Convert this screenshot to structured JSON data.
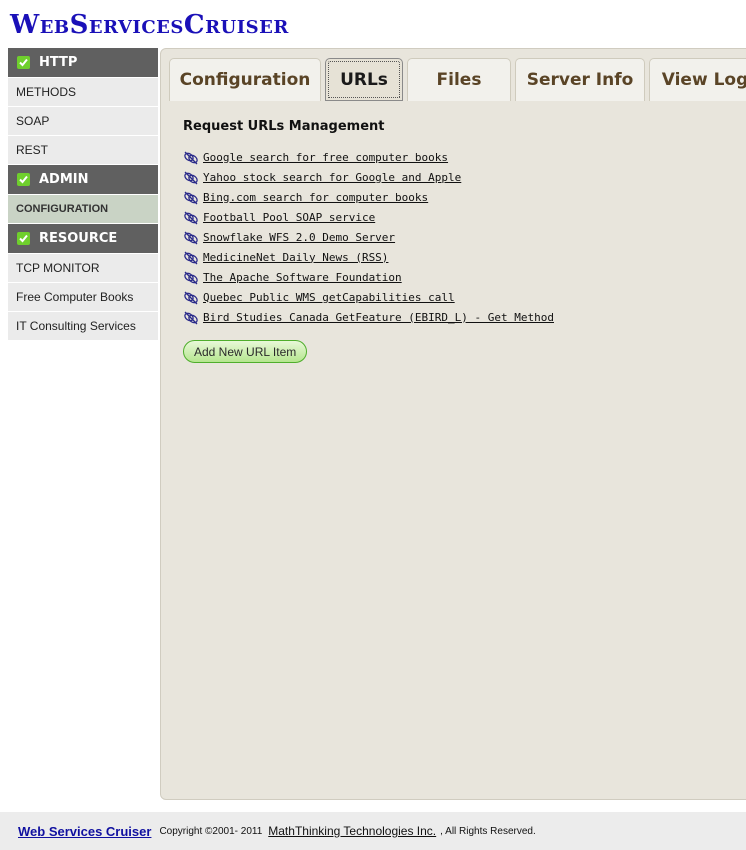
{
  "app": {
    "title": "WebServicesCruiser"
  },
  "sidebar": {
    "sections": [
      {
        "header": "HTTP",
        "items": [
          "METHODS",
          "SOAP",
          "REST"
        ]
      },
      {
        "header": "ADMIN",
        "items": [
          "CONFIGURATION"
        ]
      },
      {
        "header": "RESOURCE",
        "items": [
          "TCP MONITOR",
          "Free Computer Books",
          "IT Consulting Services"
        ]
      }
    ],
    "active_item": "CONFIGURATION"
  },
  "tabs": [
    {
      "label": "Configuration"
    },
    {
      "label": "URLs"
    },
    {
      "label": "Files"
    },
    {
      "label": "Server Info"
    },
    {
      "label": "View Log"
    }
  ],
  "active_tab": "URLs",
  "main": {
    "heading": "Request URLs Management",
    "urls": [
      "Google search for free computer books",
      "Yahoo stock search for Google and Apple",
      "Bing.com search for computer books",
      "Football Pool SOAP service",
      "Snowflake WFS 2.0 Demo Server",
      "MedicineNet Daily News (RSS)",
      "The Apache Software Foundation",
      "Quebec Public WMS getCapabilities call",
      "Bird Studies Canada GetFeature (EBIRD_L) - Get Method"
    ],
    "url_icon": "link-icon",
    "add_button": "Add New URL Item"
  },
  "footer": {
    "brand": "Web Services Cruiser",
    "copyright": "Copyright ©2001- 2011",
    "company": "MathThinking Technologies Inc.",
    "rights": ", All Rights Reserved."
  },
  "colors": {
    "logo": "#1a10b8",
    "sidebar_header": "#606060",
    "check_green": "#6fcf2d",
    "panel_bg": "#e8e5dc",
    "tab_text": "#5a4426",
    "button_border": "#4fae2c"
  }
}
